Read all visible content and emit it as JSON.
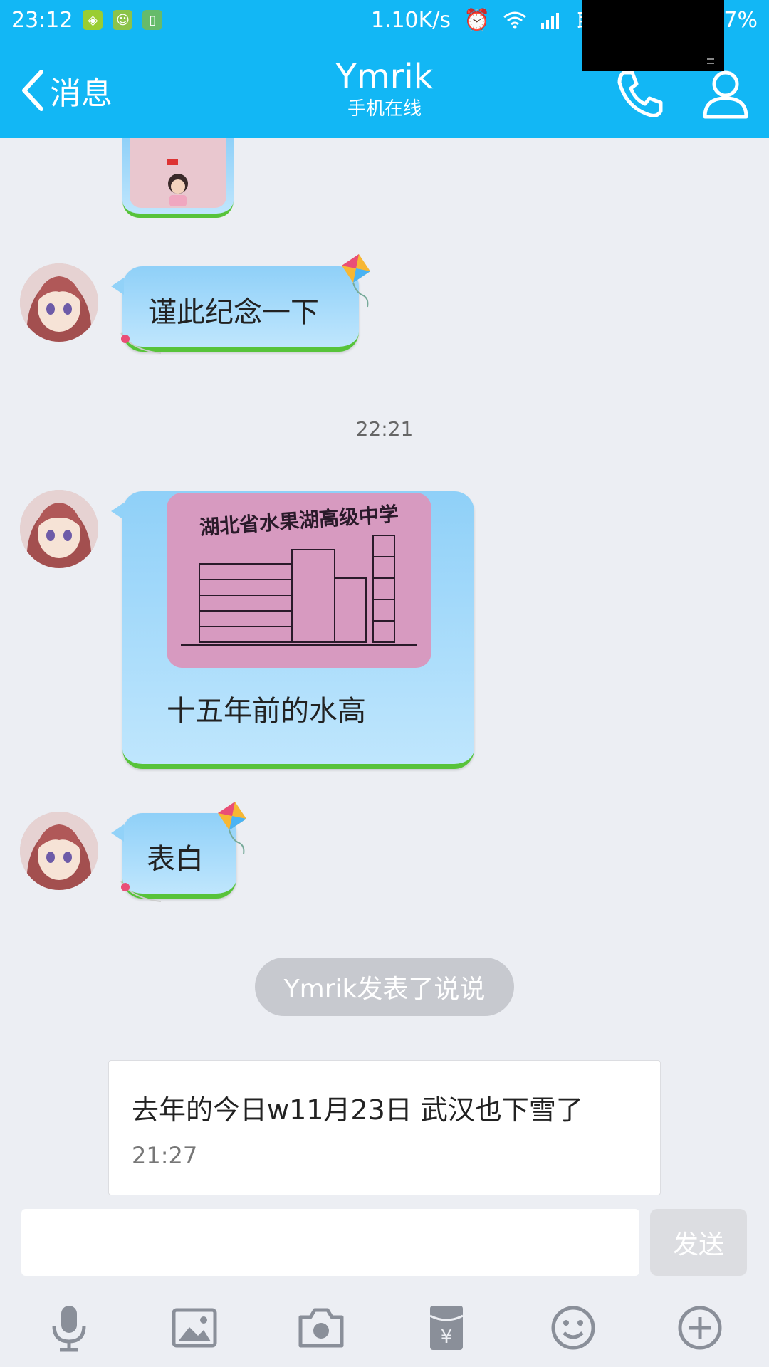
{
  "status_bar": {
    "time": "23:12",
    "net_speed": "1.10K/s",
    "carrier": "联",
    "battery": "7%"
  },
  "header": {
    "back_label": "消息",
    "contact_name": "Ymrik",
    "contact_status": "手机在线",
    "icons": [
      "back-chevron-icon",
      "phone-icon",
      "profile-icon"
    ],
    "accent_color": "#12b7f5"
  },
  "messages": [
    {
      "type": "image-partial"
    },
    {
      "type": "text",
      "text": "谨此纪念一下"
    },
    {
      "type": "time",
      "text": "22:21"
    },
    {
      "type": "image-text",
      "image_caption": "湖北省水果湖高级中学",
      "text": "十五年前的水高"
    },
    {
      "type": "text",
      "text": "表白"
    }
  ],
  "system_notice": "Ymrik发表了说说",
  "feed_card": {
    "text": "去年的今日w11月23日  武汉也下雪了",
    "time": "21:27"
  },
  "composer": {
    "placeholder": "",
    "send_label": "发送"
  },
  "toolbar": {
    "icons": [
      "microphone-icon",
      "image-icon",
      "camera-icon",
      "red-packet-icon",
      "emoji-icon",
      "plus-icon"
    ]
  }
}
